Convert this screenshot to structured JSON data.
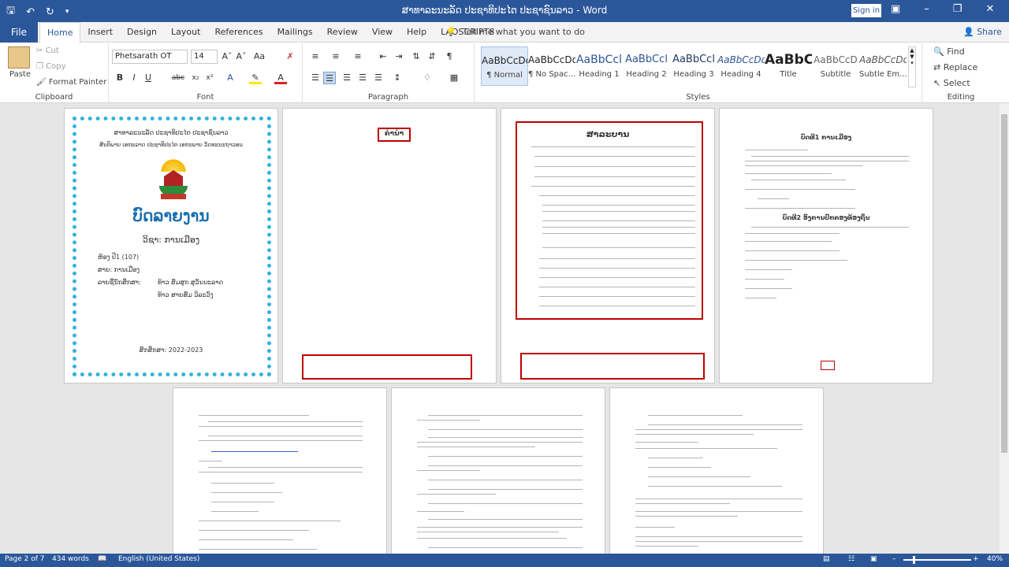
{
  "titlebar": {
    "title": "ສາທາລະນະລັດ ປະຊາທິປະໄຕ ປະຊາຊົນລາວ  -  Word",
    "signin": "Sign in",
    "qat_icons": [
      "save-icon",
      "undo-icon",
      "redo-icon",
      "customize-icon"
    ],
    "window_buttons": [
      "ribbon-display-icon",
      "minimize-icon",
      "restore-icon",
      "close-icon"
    ]
  },
  "tabs": {
    "file": "File",
    "items": [
      "Home",
      "Insert",
      "Design",
      "Layout",
      "References",
      "Mailings",
      "Review",
      "View",
      "Help",
      "LAOSCRIPT8"
    ],
    "active": "Home",
    "tell_me": "Tell me what you want to do",
    "share": "Share"
  },
  "clipboard": {
    "paste": "Paste",
    "cut": "Cut",
    "copy": "Copy",
    "format_painter": "Format Painter",
    "label": "Clipboard"
  },
  "font": {
    "name": "Phetsarath OT",
    "size": "14",
    "label": "Font"
  },
  "paragraph": {
    "label": "Paragraph"
  },
  "styles": {
    "label": "Styles",
    "items": [
      {
        "preview": "AaBbCcDd",
        "name": "¶ Normal"
      },
      {
        "preview": "AaBbCcDd",
        "name": "¶ No Spac..."
      },
      {
        "preview": "AaBbCcl",
        "name": "Heading 1"
      },
      {
        "preview": "AaBbCcl",
        "name": "Heading 2"
      },
      {
        "preview": "AaBbCcl",
        "name": "Heading 3"
      },
      {
        "preview": "AaBbCcDd",
        "name": "Heading 4"
      },
      {
        "preview": "AaBbC",
        "name": "Title"
      },
      {
        "preview": "AaBbCcD",
        "name": "Subtitle"
      },
      {
        "preview": "AaBbCcDd",
        "name": "Subtle Em..."
      }
    ]
  },
  "editing": {
    "find": "Find",
    "replace": "Replace",
    "select": "Select",
    "label": "Editing"
  },
  "pages": {
    "cover": {
      "line1": "ສາທາລະນະລັດ ປະຊາທິປະໄຕ ປະຊາຊົນລາວ",
      "line2": "ສັນຕິພາບ ເອກະລາດ ປະຊາທິປະໄຕ ເອກະພາບ ວັດທະນະຖາວອນ",
      "report_title": "ບົດລາຍງານ",
      "subject": "ວິຊາ: ການເມືອງ",
      "class": "ຫ້ອງ ປີ1 (107)",
      "major": "ສາຍ: ການເມືອງ",
      "students_label": "ລາຍຊື່ນັກສຶກສາ:",
      "student1": "ທ້າວ ສົມສຸກ ສຸວັນນະລາດ",
      "student2": "ທ້າວ ສາຍສົມ ວິລະວົງ",
      "school_year": "ສົກສຶກສາ: 2022-2023"
    },
    "preface_title": "ຄໍານໍາ",
    "toc_title": "ສາລະບານ",
    "chapter1_title": "ບົດທີ1 ການເມືອງ",
    "chapter2_title": "ບົດທີ2 ອົງການປົກຄອງທ້ອງຖິ່ນ"
  },
  "statusbar": {
    "page": "Page 2 of 7",
    "words": "434 words",
    "language": "English (United States)",
    "zoom": "40%"
  }
}
